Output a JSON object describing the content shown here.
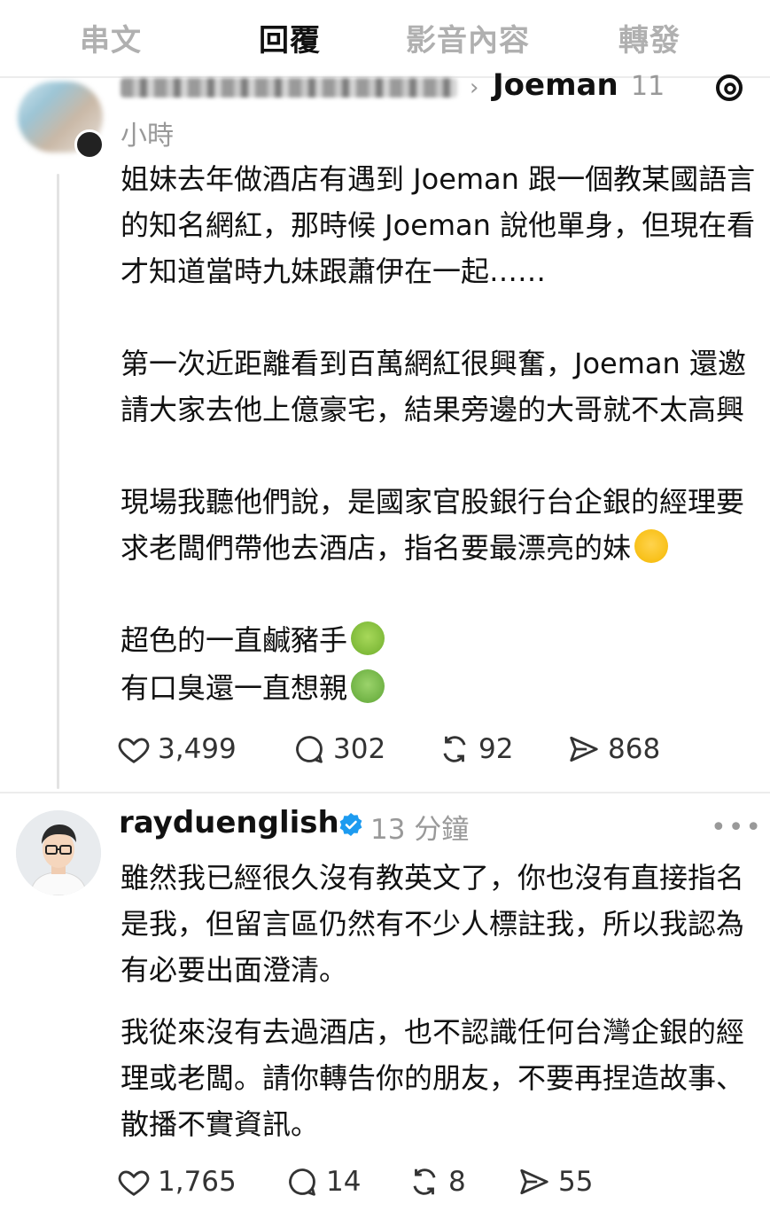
{
  "tabs": [
    "串文",
    "回覆",
    "影音內容",
    "轉發"
  ],
  "active_tab": "回覆",
  "post1": {
    "reply_to": "Joeman",
    "time_part1": "11",
    "time_part2": "小時",
    "paragraphs": [
      "姐妹去年做酒店有遇到 Joeman 跟一個教某國語言的知名網紅，那時候 Joeman 說他單身，但現在看才知道當時九妹跟蕭伊在一起……",
      "第一次近距離看到百萬網紅很興奮，Joeman 還邀請大家去他上億豪宅，結果旁邊的大哥就不太高興",
      "現場我聽他們說，是國家官股銀行台企銀的經理要求老闆們帶他去酒店，指名要最漂亮的妹",
      "超色的一直鹹豬手",
      "有口臭還一直想親"
    ],
    "likes": "3,499",
    "comments": "302",
    "reposts": "92",
    "shares": "868"
  },
  "post2": {
    "username": "rayduenglish",
    "time": "13 分鐘",
    "paragraph1": "雖然我已經很久沒有教英文了，你也沒有直接指名是我，但留言區仍然有不少人標註我，所以我認為有必要出面澄清。",
    "paragraph2": "我從來沒有去過酒店，也不認識任何台灣企銀的經理或老闆。請你轉告你的朋友，不要再捏造故事、散播不實資訊。",
    "likes": "1,765",
    "comments": "14",
    "reposts": "8",
    "shares": "55"
  },
  "icons": {
    "like": "heart-icon",
    "comment": "comment-bubble-icon",
    "repost": "repost-icon",
    "share": "share-send-icon",
    "verified": "verified-badge-icon",
    "more": "more-dots-icon",
    "threads": "threads-logo-icon"
  },
  "colors": {
    "text": "#111111",
    "muted": "#999999",
    "verified": "#1d9bf0"
  }
}
